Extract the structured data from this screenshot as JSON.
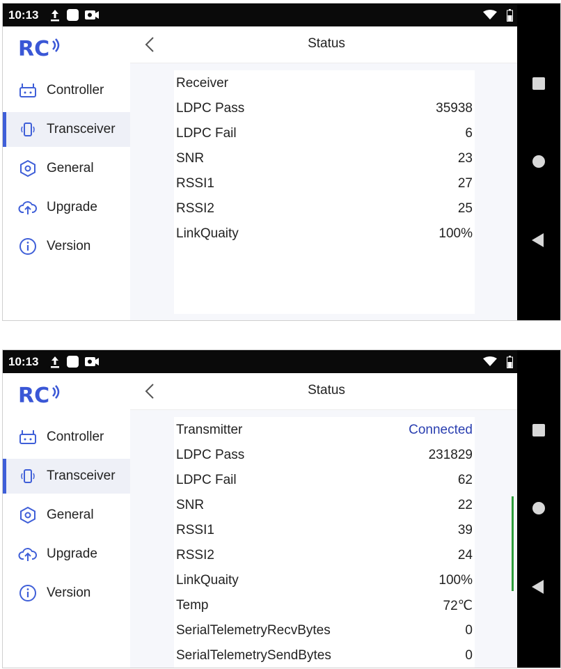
{
  "screens": [
    {
      "status_bar": {
        "time": "10:13"
      },
      "header": {
        "title": "Status"
      },
      "sidebar": {
        "items": [
          {
            "label": "Controller",
            "icon": "controller-icon"
          },
          {
            "label": "Transceiver",
            "icon": "transceiver-icon",
            "active": true
          },
          {
            "label": "General",
            "icon": "hexagon-settings-icon"
          },
          {
            "label": "Upgrade",
            "icon": "cloud-upload-icon"
          },
          {
            "label": "Version",
            "icon": "info-icon"
          }
        ]
      },
      "card": {
        "rows": [
          {
            "label": "Receiver",
            "value": ""
          },
          {
            "label": "LDPC Pass",
            "value": "35938"
          },
          {
            "label": "LDPC Fail",
            "value": "6"
          },
          {
            "label": "SNR",
            "value": "23"
          },
          {
            "label": "RSSI1",
            "value": "27"
          },
          {
            "label": "RSSI2",
            "value": "25"
          },
          {
            "label": "LinkQuaity",
            "value": "100%"
          }
        ]
      }
    },
    {
      "status_bar": {
        "time": "10:13"
      },
      "header": {
        "title": "Status"
      },
      "sidebar": {
        "items": [
          {
            "label": "Controller",
            "icon": "controller-icon"
          },
          {
            "label": "Transceiver",
            "icon": "transceiver-icon",
            "active": true
          },
          {
            "label": "General",
            "icon": "hexagon-settings-icon"
          },
          {
            "label": "Upgrade",
            "icon": "cloud-upload-icon"
          },
          {
            "label": "Version",
            "icon": "info-icon"
          }
        ]
      },
      "card": {
        "rows": [
          {
            "label": "Transmitter",
            "value": "Connected"
          },
          {
            "label": "LDPC Pass",
            "value": "231829"
          },
          {
            "label": "LDPC Fail",
            "value": "62"
          },
          {
            "label": "SNR",
            "value": "22"
          },
          {
            "label": "RSSI1",
            "value": "39"
          },
          {
            "label": "RSSI2",
            "value": "24"
          },
          {
            "label": "LinkQuaity",
            "value": "100%"
          },
          {
            "label": "Temp",
            "value": "72℃"
          },
          {
            "label": "SerialTelemetryRecvBytes",
            "value": "0"
          },
          {
            "label": "SerialTelemetrySendBytes",
            "value": "0"
          }
        ]
      }
    }
  ],
  "colors": {
    "accent": "#3f5fd8",
    "connected": "#2a3fb0",
    "scrollbar": "#2e9c3c"
  }
}
